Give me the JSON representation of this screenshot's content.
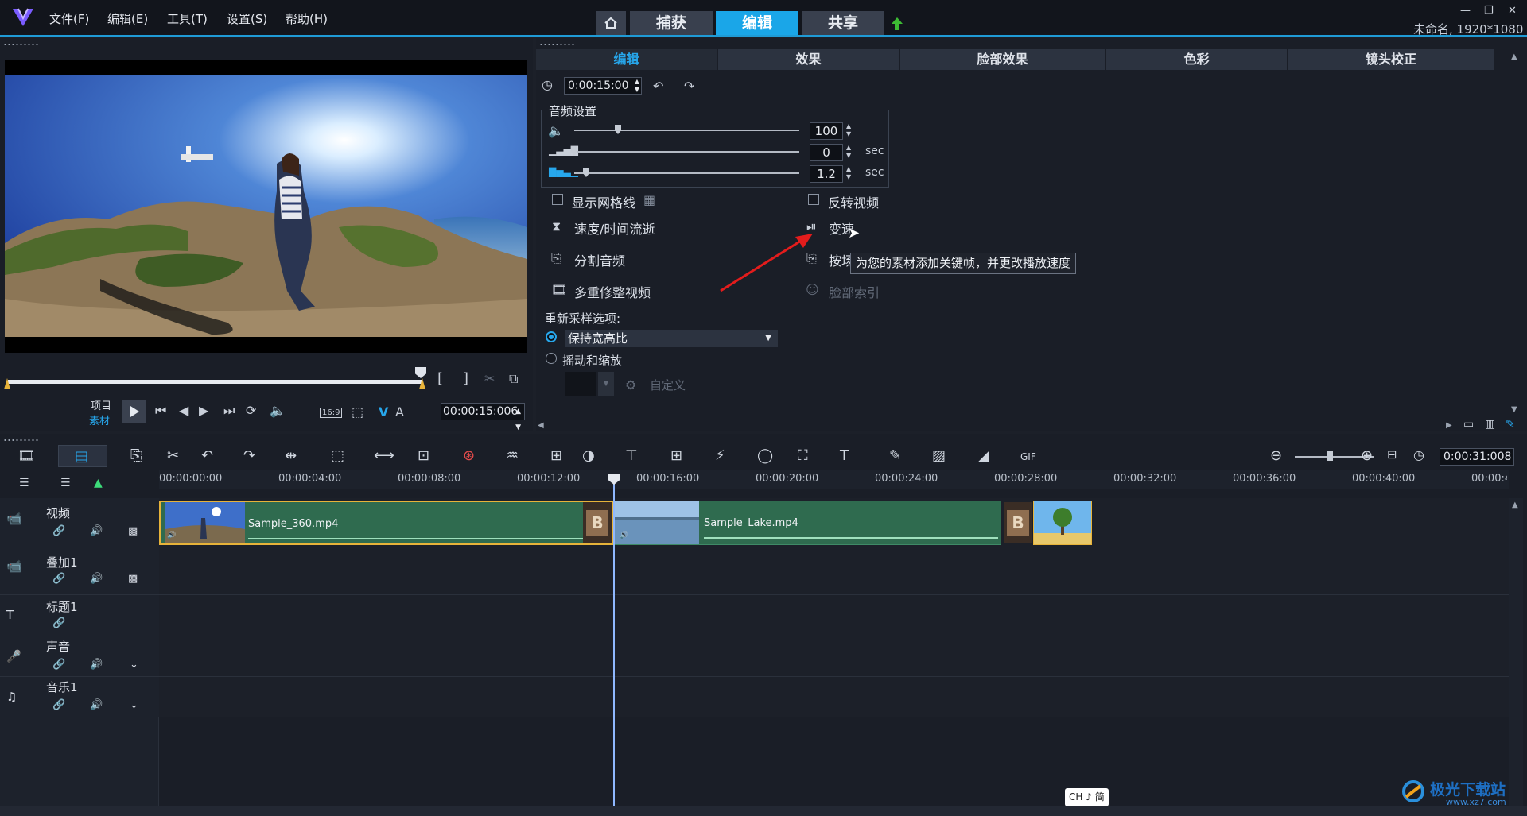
{
  "app": {
    "menu": [
      "文件(F)",
      "编辑(E)",
      "工具(T)",
      "设置(S)",
      "帮助(H)"
    ],
    "mode_tabs": [
      "捕获",
      "编辑",
      "共享"
    ],
    "project_info": "未命名, 1920*1080"
  },
  "preview": {
    "project_label": "项目",
    "clip_label": "素材",
    "aspect_label": "16:9",
    "timecode": "00:00:15:006"
  },
  "options": {
    "tabs": [
      "编辑",
      "效果",
      "脸部效果",
      "色彩",
      "镜头校正"
    ],
    "duration": "0:00:15:00",
    "audio_group_label": "音频设置",
    "volume": "100",
    "fade_in": "0",
    "fade_out": "1.2",
    "unit_sec": "sec",
    "show_grid": "显示网格线",
    "reverse_video": "反转视频",
    "speed_time_lapse": "速度/时间流逝",
    "variable_speed": "变速",
    "split_audio": "分割音频",
    "split_by_scene": "按场",
    "multi_trim": "多重修整视频",
    "face_index": "脸部索引",
    "tooltip": "为您的素材添加关键帧，并更改播放速度",
    "resample_label": "重新采样选项:",
    "keep_aspect": "保持宽高比",
    "pan_zoom": "摇动和缩放",
    "customize": "自定义"
  },
  "timeline": {
    "zoom_timecode": "0:00:31:008",
    "ruler": [
      "00:00:00:00",
      "00:00:04:00",
      "00:00:08:00",
      "00:00:12:00",
      "00:00:16:00",
      "00:00:20:00",
      "00:00:24:00",
      "00:00:28:00",
      "00:00:32:00",
      "00:00:36:00",
      "00:00:40:00",
      "00:00:4"
    ],
    "tracks": [
      "视频",
      "叠加1",
      "标题1",
      "声音",
      "音乐1"
    ],
    "clips": [
      "Sample_360.mp4",
      "Sample_Lake.mp4"
    ],
    "transition_letter": "B"
  },
  "ime": "CH ♪ 简",
  "watermark": "极光下载站",
  "watermark_url": "www.xz7.com"
}
